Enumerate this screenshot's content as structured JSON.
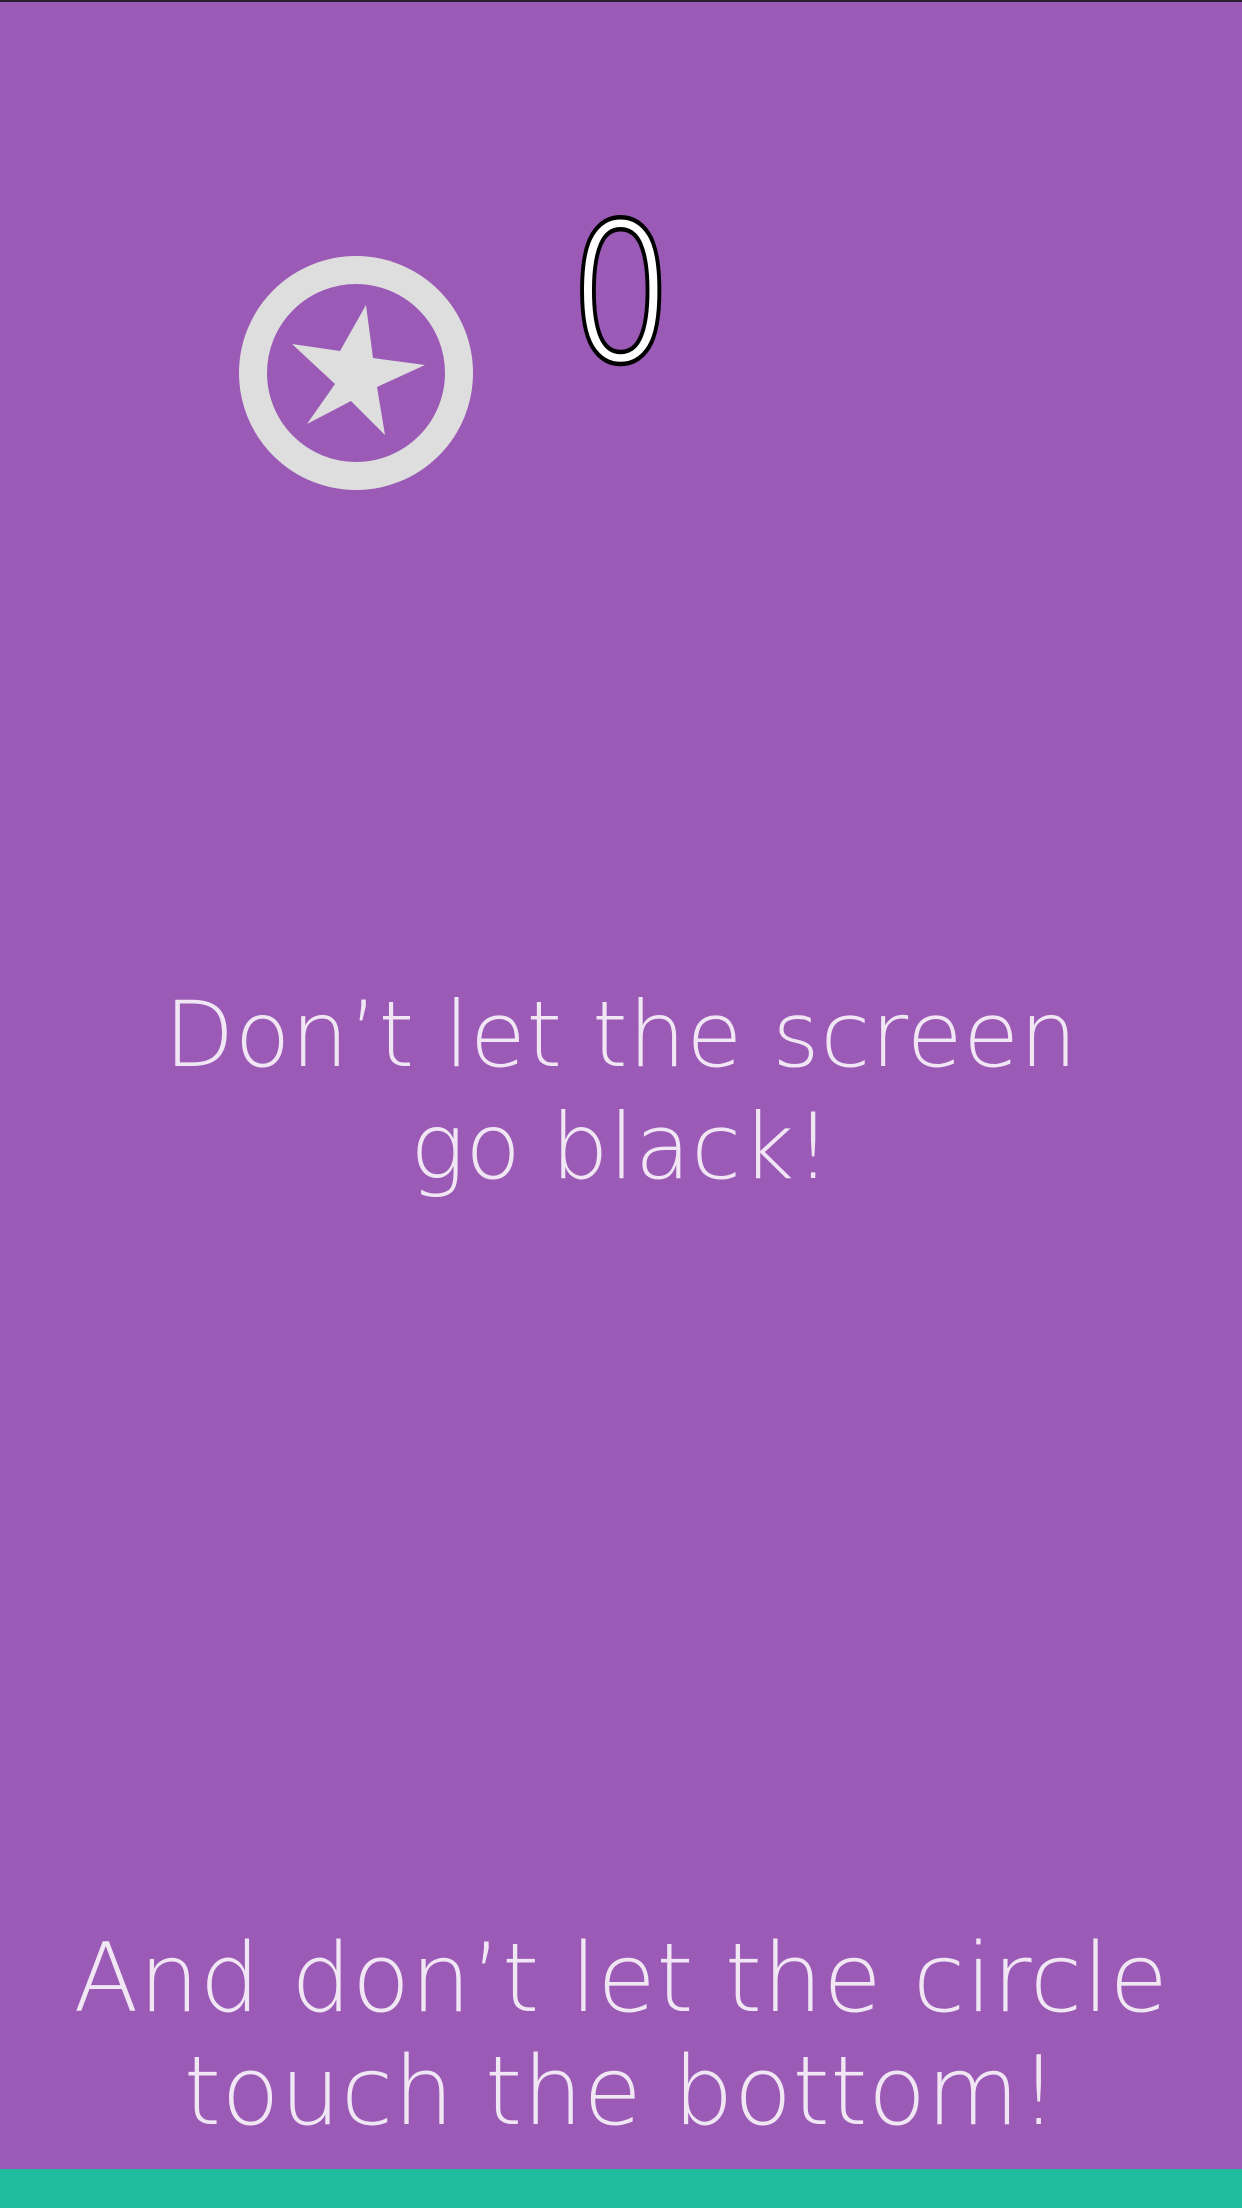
{
  "game": {
    "score": "0",
    "instruction_main": "Don’t let the screen\ngo black!",
    "instruction_bottom": "And don’t let the circle\ntouch the bottom!",
    "icon": "star-circle-icon"
  },
  "colors": {
    "background": "#9a5ab5",
    "text": "#f0e6f4",
    "score_fill": "#ffffff",
    "score_outline": "#000000",
    "badge": "#dedede",
    "bottom_bar": "#1fbca0"
  }
}
